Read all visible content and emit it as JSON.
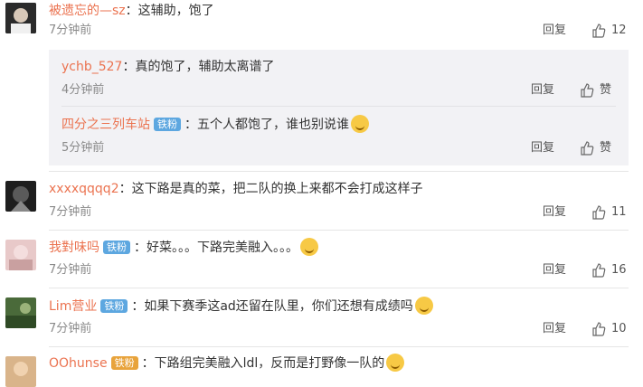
{
  "comments": [
    {
      "user": "被遗忘的—sz",
      "sep": "：",
      "text": "这辅助，饱了",
      "time": "7分钟前",
      "reply": "回复",
      "likes": "12"
    },
    {
      "user": "xxxxqqqq2",
      "sep": "：",
      "text": "这下路是真的菜，把二队的换上来都不会打成这样子",
      "time": "7分钟前",
      "reply": "回复",
      "likes": "11"
    },
    {
      "user": "我對味吗",
      "badge": "铁粉",
      "sep": "：",
      "text": "好菜。。。下路完美融入。。。",
      "time": "7分钟前",
      "reply": "回复",
      "likes": "16"
    },
    {
      "user": "Lim营业",
      "badge": "铁粉",
      "sep": "：",
      "text": "如果下赛季这ad还留在队里，你们还想有成绩吗",
      "time": "7分钟前",
      "reply": "回复",
      "likes": "10"
    },
    {
      "user": "OOhunse",
      "badge": "铁粉",
      "sep": "：",
      "text": "下路组完美融入ldl，反而是打野像一队的"
    }
  ],
  "subreplies": [
    {
      "user": "ychb_527",
      "sep": "：",
      "text": "真的饱了，辅助太离谱了",
      "time": "4分钟前",
      "reply": "回复",
      "likes": "赞"
    },
    {
      "user": "四分之三列车站",
      "badge": "铁粉",
      "sep": "：",
      "text": "五个人都饱了，谁也别说谁",
      "time": "5分钟前",
      "reply": "回复",
      "likes": "赞"
    }
  ],
  "colors": {
    "username": "#eb7350",
    "badge": "#5da7e0",
    "badge_gold": "#e8a33b",
    "time": "#8a8a8a",
    "subbox": "#f2f2f5"
  }
}
